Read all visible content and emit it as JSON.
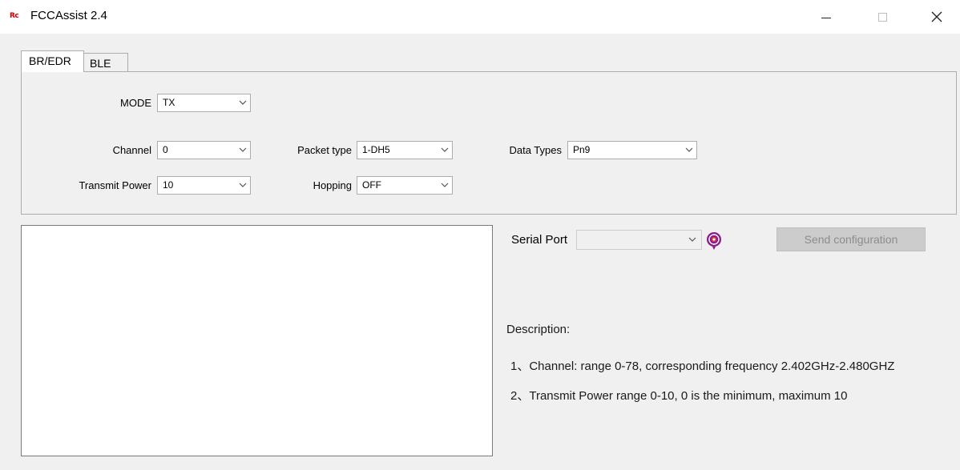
{
  "window": {
    "logo_text": "Rc",
    "title": "FCCAssist 2.4",
    "minimize_icon": "minimize-icon",
    "maximize_icon": "maximize-icon",
    "close_icon": "close-icon"
  },
  "tabs": [
    {
      "label": "BR/EDR",
      "active": true
    },
    {
      "label": "BLE",
      "active": false
    }
  ],
  "config": {
    "mode": {
      "label": "MODE",
      "value": "TX"
    },
    "channel": {
      "label": "Channel",
      "value": "0"
    },
    "transmit_power": {
      "label": "Transmit Power",
      "value": "10"
    },
    "packet_type": {
      "label": "Packet type",
      "value": "1-DH5"
    },
    "hopping": {
      "label": "Hopping",
      "value": "OFF"
    },
    "data_types": {
      "label": "Data Types",
      "value": "Pn9"
    }
  },
  "serial": {
    "label": "Serial Port",
    "value": "",
    "refresh_icon": "refresh-icon"
  },
  "send_button": {
    "label": "Send configuration",
    "enabled": false
  },
  "description": {
    "heading": "Description:",
    "lines": [
      "1、Channel: range 0-78, corresponding frequency 2.402GHz-2.480GHZ",
      "2、Transmit Power  range 0-10, 0 is the minimum, maximum 10"
    ]
  },
  "colors": {
    "logo": "#d40000",
    "refresh_icon": "#8b1a8b",
    "button_disabled_bg": "#cccccc",
    "button_disabled_text": "#8c8c8c"
  }
}
